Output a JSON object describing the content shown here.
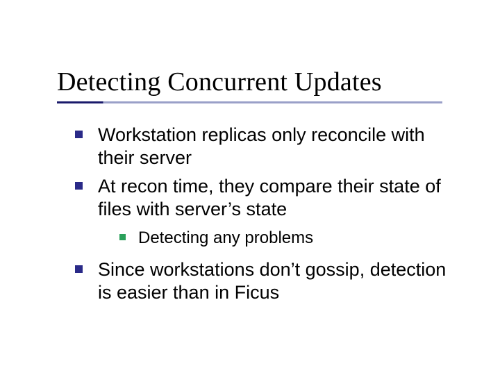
{
  "slide": {
    "title": "Detecting Concurrent Updates",
    "bullets": [
      {
        "text": "Workstation replicas only reconcile with their server"
      },
      {
        "text": "At recon time, they compare their state of files with server’s state",
        "sub": [
          {
            "text": "Detecting any problems"
          }
        ]
      },
      {
        "text": "Since workstations don’t gossip, detection is easier than in Ficus"
      }
    ]
  }
}
